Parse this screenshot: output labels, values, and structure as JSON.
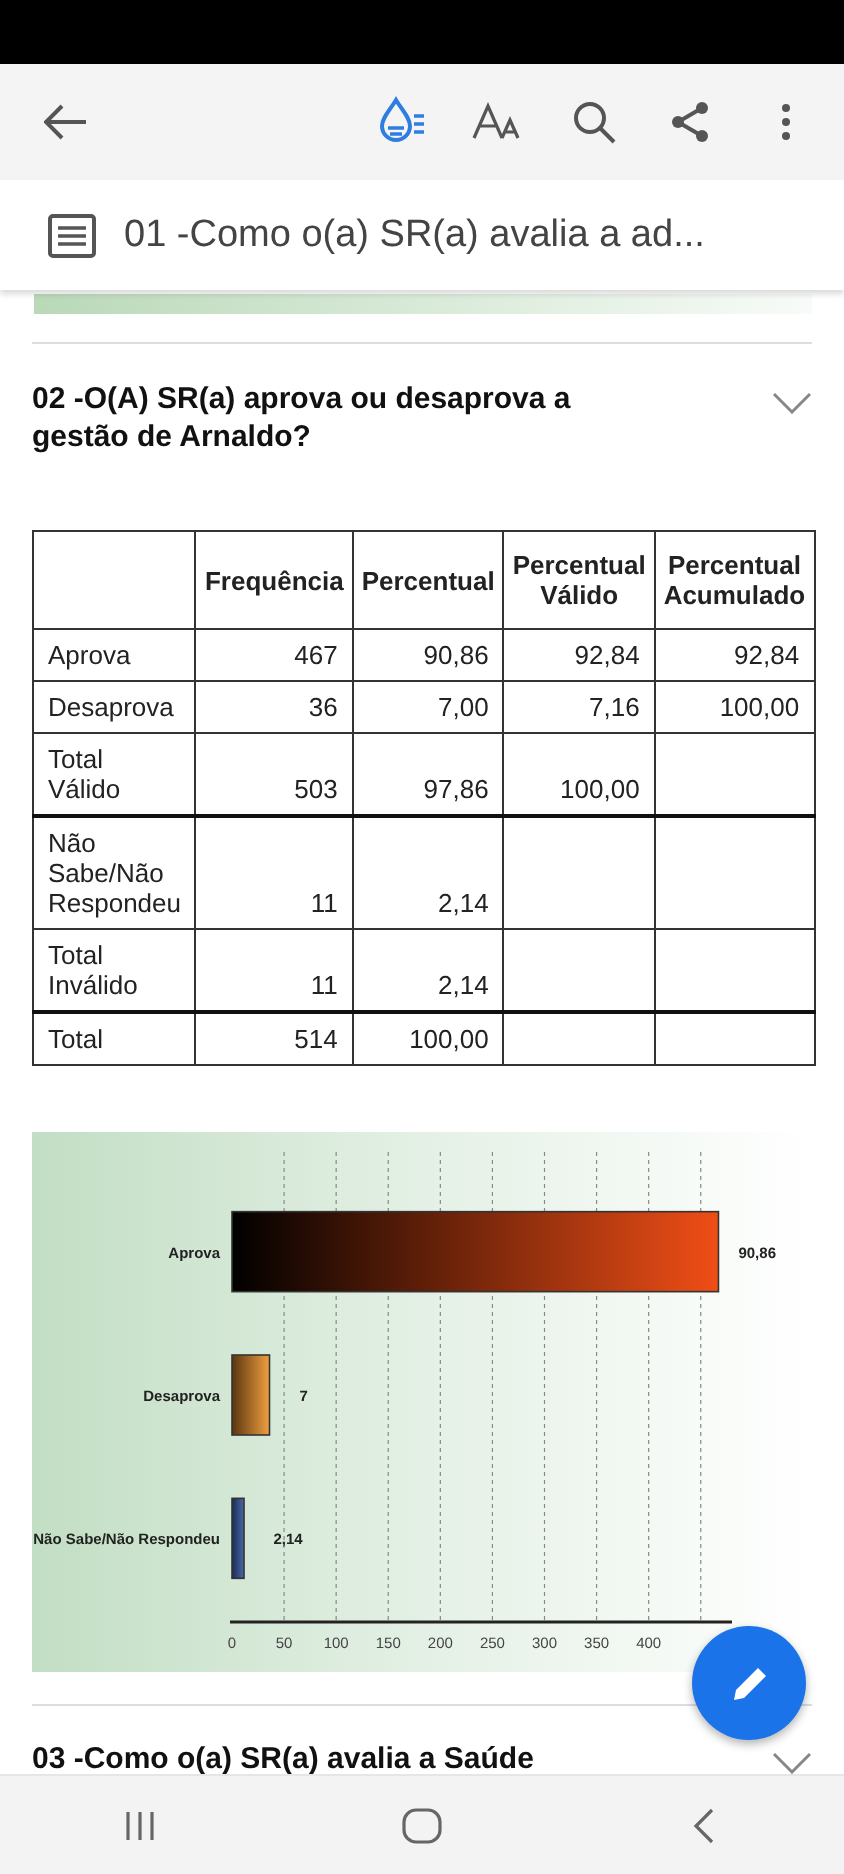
{
  "toolbar": {
    "doc_title": "01 -Como o(a) SR(a) avalia a ad..."
  },
  "section": {
    "title": "02 -O(A) SR(a) aprova ou desaprova a gestão de Arnaldo?",
    "expanded": true
  },
  "table": {
    "columns": [
      "",
      "Frequência",
      "Percentual",
      "Percentual Válido",
      "Percentual Acumulado"
    ],
    "rows": [
      {
        "cells": [
          "Aprova",
          "467",
          "90,86",
          "92,84",
          "92,84"
        ],
        "group_end": false
      },
      {
        "cells": [
          "Desaprova",
          "36",
          "7,00",
          "7,16",
          "100,00"
        ],
        "group_end": false
      },
      {
        "cells": [
          "Total Válido",
          "503",
          "97,86",
          "100,00",
          ""
        ],
        "group_end": true
      },
      {
        "cells": [
          "Não Sabe/Não Respondeu",
          "11",
          "2,14",
          "",
          ""
        ],
        "group_end": false
      },
      {
        "cells": [
          "Total Inválido",
          "11",
          "2,14",
          "",
          ""
        ],
        "group_end": true
      },
      {
        "cells": [
          "Total",
          "514",
          "100,00",
          "",
          ""
        ],
        "group_end": false
      }
    ]
  },
  "chart_data": {
    "type": "bar",
    "orientation": "horizontal",
    "categories": [
      "Aprova",
      "Desaprova",
      "Não Sabe/Não Respondeu"
    ],
    "values": [
      467,
      36,
      11
    ],
    "grid": true,
    "xlim": [
      0,
      480
    ],
    "xticks": [
      0,
      50,
      100,
      150,
      200,
      250,
      300,
      350,
      400
    ],
    "annotations": [
      "90,86",
      "7",
      "2,14"
    ]
  },
  "next_section": {
    "title": "03 -Como o(a) SR(a) avalia a Saúde",
    "expanded": false
  }
}
